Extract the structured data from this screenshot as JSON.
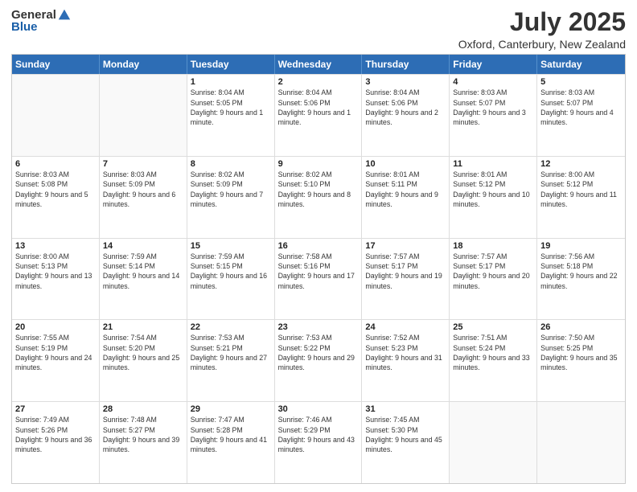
{
  "logo": {
    "general": "General",
    "blue": "Blue"
  },
  "title": "July 2025",
  "subtitle": "Oxford, Canterbury, New Zealand",
  "days": [
    "Sunday",
    "Monday",
    "Tuesday",
    "Wednesday",
    "Thursday",
    "Friday",
    "Saturday"
  ],
  "weeks": [
    [
      {
        "day": "",
        "info": ""
      },
      {
        "day": "",
        "info": ""
      },
      {
        "day": "1",
        "info": "Sunrise: 8:04 AM\nSunset: 5:05 PM\nDaylight: 9 hours and 1 minute."
      },
      {
        "day": "2",
        "info": "Sunrise: 8:04 AM\nSunset: 5:06 PM\nDaylight: 9 hours and 1 minute."
      },
      {
        "day": "3",
        "info": "Sunrise: 8:04 AM\nSunset: 5:06 PM\nDaylight: 9 hours and 2 minutes."
      },
      {
        "day": "4",
        "info": "Sunrise: 8:03 AM\nSunset: 5:07 PM\nDaylight: 9 hours and 3 minutes."
      },
      {
        "day": "5",
        "info": "Sunrise: 8:03 AM\nSunset: 5:07 PM\nDaylight: 9 hours and 4 minutes."
      }
    ],
    [
      {
        "day": "6",
        "info": "Sunrise: 8:03 AM\nSunset: 5:08 PM\nDaylight: 9 hours and 5 minutes."
      },
      {
        "day": "7",
        "info": "Sunrise: 8:03 AM\nSunset: 5:09 PM\nDaylight: 9 hours and 6 minutes."
      },
      {
        "day": "8",
        "info": "Sunrise: 8:02 AM\nSunset: 5:09 PM\nDaylight: 9 hours and 7 minutes."
      },
      {
        "day": "9",
        "info": "Sunrise: 8:02 AM\nSunset: 5:10 PM\nDaylight: 9 hours and 8 minutes."
      },
      {
        "day": "10",
        "info": "Sunrise: 8:01 AM\nSunset: 5:11 PM\nDaylight: 9 hours and 9 minutes."
      },
      {
        "day": "11",
        "info": "Sunrise: 8:01 AM\nSunset: 5:12 PM\nDaylight: 9 hours and 10 minutes."
      },
      {
        "day": "12",
        "info": "Sunrise: 8:00 AM\nSunset: 5:12 PM\nDaylight: 9 hours and 11 minutes."
      }
    ],
    [
      {
        "day": "13",
        "info": "Sunrise: 8:00 AM\nSunset: 5:13 PM\nDaylight: 9 hours and 13 minutes."
      },
      {
        "day": "14",
        "info": "Sunrise: 7:59 AM\nSunset: 5:14 PM\nDaylight: 9 hours and 14 minutes."
      },
      {
        "day": "15",
        "info": "Sunrise: 7:59 AM\nSunset: 5:15 PM\nDaylight: 9 hours and 16 minutes."
      },
      {
        "day": "16",
        "info": "Sunrise: 7:58 AM\nSunset: 5:16 PM\nDaylight: 9 hours and 17 minutes."
      },
      {
        "day": "17",
        "info": "Sunrise: 7:57 AM\nSunset: 5:17 PM\nDaylight: 9 hours and 19 minutes."
      },
      {
        "day": "18",
        "info": "Sunrise: 7:57 AM\nSunset: 5:17 PM\nDaylight: 9 hours and 20 minutes."
      },
      {
        "day": "19",
        "info": "Sunrise: 7:56 AM\nSunset: 5:18 PM\nDaylight: 9 hours and 22 minutes."
      }
    ],
    [
      {
        "day": "20",
        "info": "Sunrise: 7:55 AM\nSunset: 5:19 PM\nDaylight: 9 hours and 24 minutes."
      },
      {
        "day": "21",
        "info": "Sunrise: 7:54 AM\nSunset: 5:20 PM\nDaylight: 9 hours and 25 minutes."
      },
      {
        "day": "22",
        "info": "Sunrise: 7:53 AM\nSunset: 5:21 PM\nDaylight: 9 hours and 27 minutes."
      },
      {
        "day": "23",
        "info": "Sunrise: 7:53 AM\nSunset: 5:22 PM\nDaylight: 9 hours and 29 minutes."
      },
      {
        "day": "24",
        "info": "Sunrise: 7:52 AM\nSunset: 5:23 PM\nDaylight: 9 hours and 31 minutes."
      },
      {
        "day": "25",
        "info": "Sunrise: 7:51 AM\nSunset: 5:24 PM\nDaylight: 9 hours and 33 minutes."
      },
      {
        "day": "26",
        "info": "Sunrise: 7:50 AM\nSunset: 5:25 PM\nDaylight: 9 hours and 35 minutes."
      }
    ],
    [
      {
        "day": "27",
        "info": "Sunrise: 7:49 AM\nSunset: 5:26 PM\nDaylight: 9 hours and 36 minutes."
      },
      {
        "day": "28",
        "info": "Sunrise: 7:48 AM\nSunset: 5:27 PM\nDaylight: 9 hours and 39 minutes."
      },
      {
        "day": "29",
        "info": "Sunrise: 7:47 AM\nSunset: 5:28 PM\nDaylight: 9 hours and 41 minutes."
      },
      {
        "day": "30",
        "info": "Sunrise: 7:46 AM\nSunset: 5:29 PM\nDaylight: 9 hours and 43 minutes."
      },
      {
        "day": "31",
        "info": "Sunrise: 7:45 AM\nSunset: 5:30 PM\nDaylight: 9 hours and 45 minutes."
      },
      {
        "day": "",
        "info": ""
      },
      {
        "day": "",
        "info": ""
      }
    ]
  ]
}
